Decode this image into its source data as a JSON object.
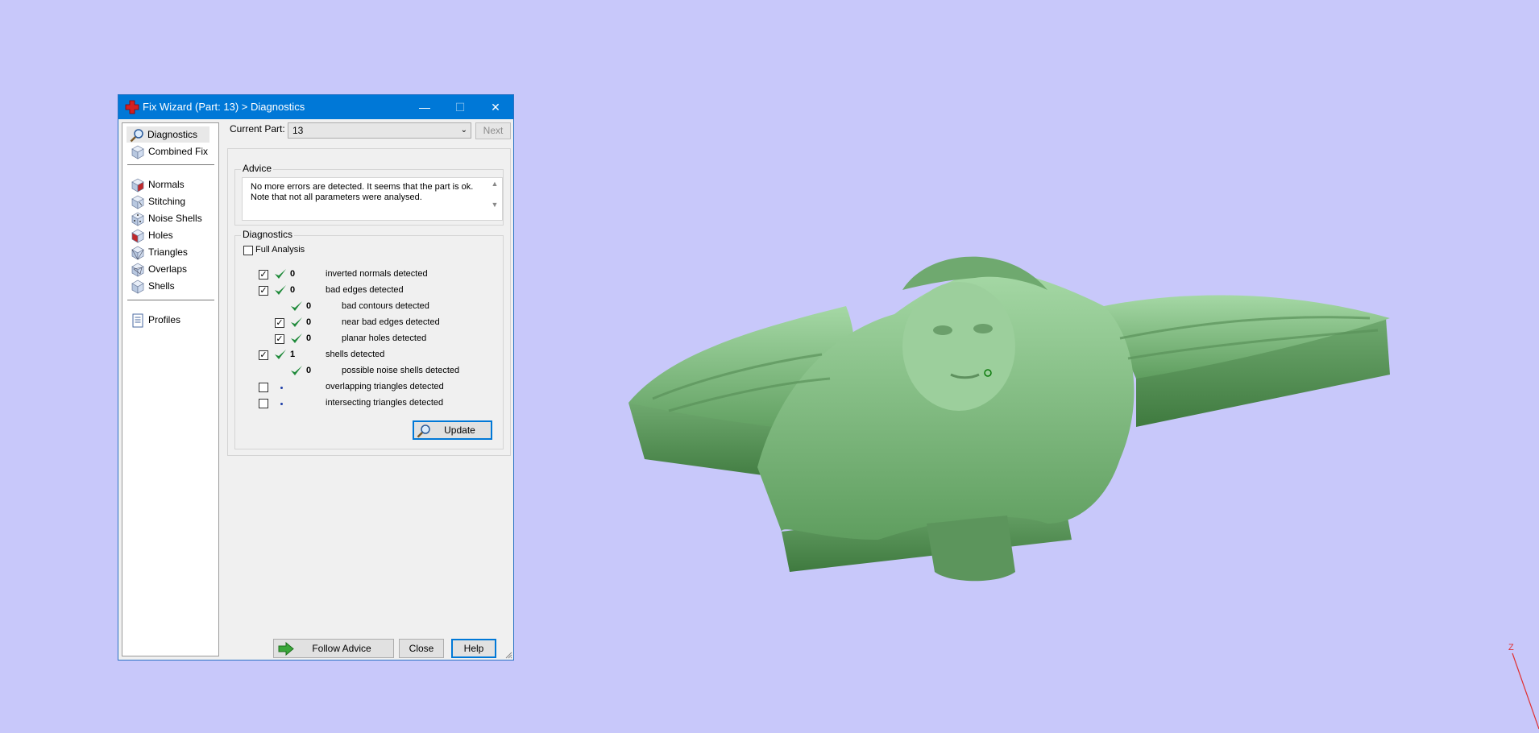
{
  "window": {
    "title": "Fix Wizard (Part: 13) > Diagnostics",
    "controls": {
      "minimize": "—",
      "maximize": "☐",
      "close": "✕"
    }
  },
  "nav": {
    "items": [
      {
        "label": "Diagnostics",
        "icon": "magnifier-icon",
        "selected": true
      },
      {
        "label": "Combined Fix",
        "icon": "cube-icon"
      },
      {
        "label": "Normals",
        "icon": "cube-red-face-icon"
      },
      {
        "label": "Stitching",
        "icon": "cube-stitch-icon"
      },
      {
        "label": "Noise Shells",
        "icon": "cube-noise-icon"
      },
      {
        "label": "Holes",
        "icon": "cube-red-face-icon"
      },
      {
        "label": "Triangles",
        "icon": "cube-triangle-icon"
      },
      {
        "label": "Overlaps",
        "icon": "cube-overlap-icon"
      },
      {
        "label": "Shells",
        "icon": "cube-shell-icon"
      },
      {
        "label": "Profiles",
        "icon": "profile-sheet-icon"
      }
    ]
  },
  "current_part": {
    "label": "Current Part:",
    "value": "13",
    "next_label": "Next"
  },
  "advice": {
    "title": "Advice",
    "text_line1": "No more errors are detected. It seems that the part is ok.",
    "text_line2": "Note that not all parameters were analysed."
  },
  "diagnostics": {
    "title": "Diagnostics",
    "full_analysis_label": "Full Analysis",
    "rows": [
      {
        "checked": true,
        "status": "ok",
        "count": "0",
        "label": "inverted normals detected"
      },
      {
        "checked": true,
        "status": "ok",
        "count": "0",
        "label": "bad edges detected"
      },
      {
        "checked": null,
        "status": "ok",
        "count": "0",
        "label": "bad contours detected"
      },
      {
        "checked": true,
        "status": "ok",
        "count": "0",
        "label": "near bad edges detected"
      },
      {
        "checked": true,
        "status": "ok",
        "count": "0",
        "label": "planar holes detected"
      },
      {
        "checked": true,
        "status": "ok",
        "count": "1",
        "label": "shells detected"
      },
      {
        "checked": null,
        "status": "ok",
        "count": "0",
        "label": "possible noise shells detected"
      },
      {
        "checked": false,
        "status": "not-analysed",
        "count": "",
        "label": "overlapping triangles detected"
      },
      {
        "checked": false,
        "status": "not-analysed",
        "count": "",
        "label": "intersecting triangles detected"
      }
    ],
    "update_label": "Update"
  },
  "footer": {
    "follow_advice_label": "Follow Advice",
    "close_label": "Close",
    "help_label": "Help"
  },
  "viewport": {
    "axis_label": "Z",
    "model_color": "#7fbf7f",
    "background": "#c8c8fa"
  }
}
